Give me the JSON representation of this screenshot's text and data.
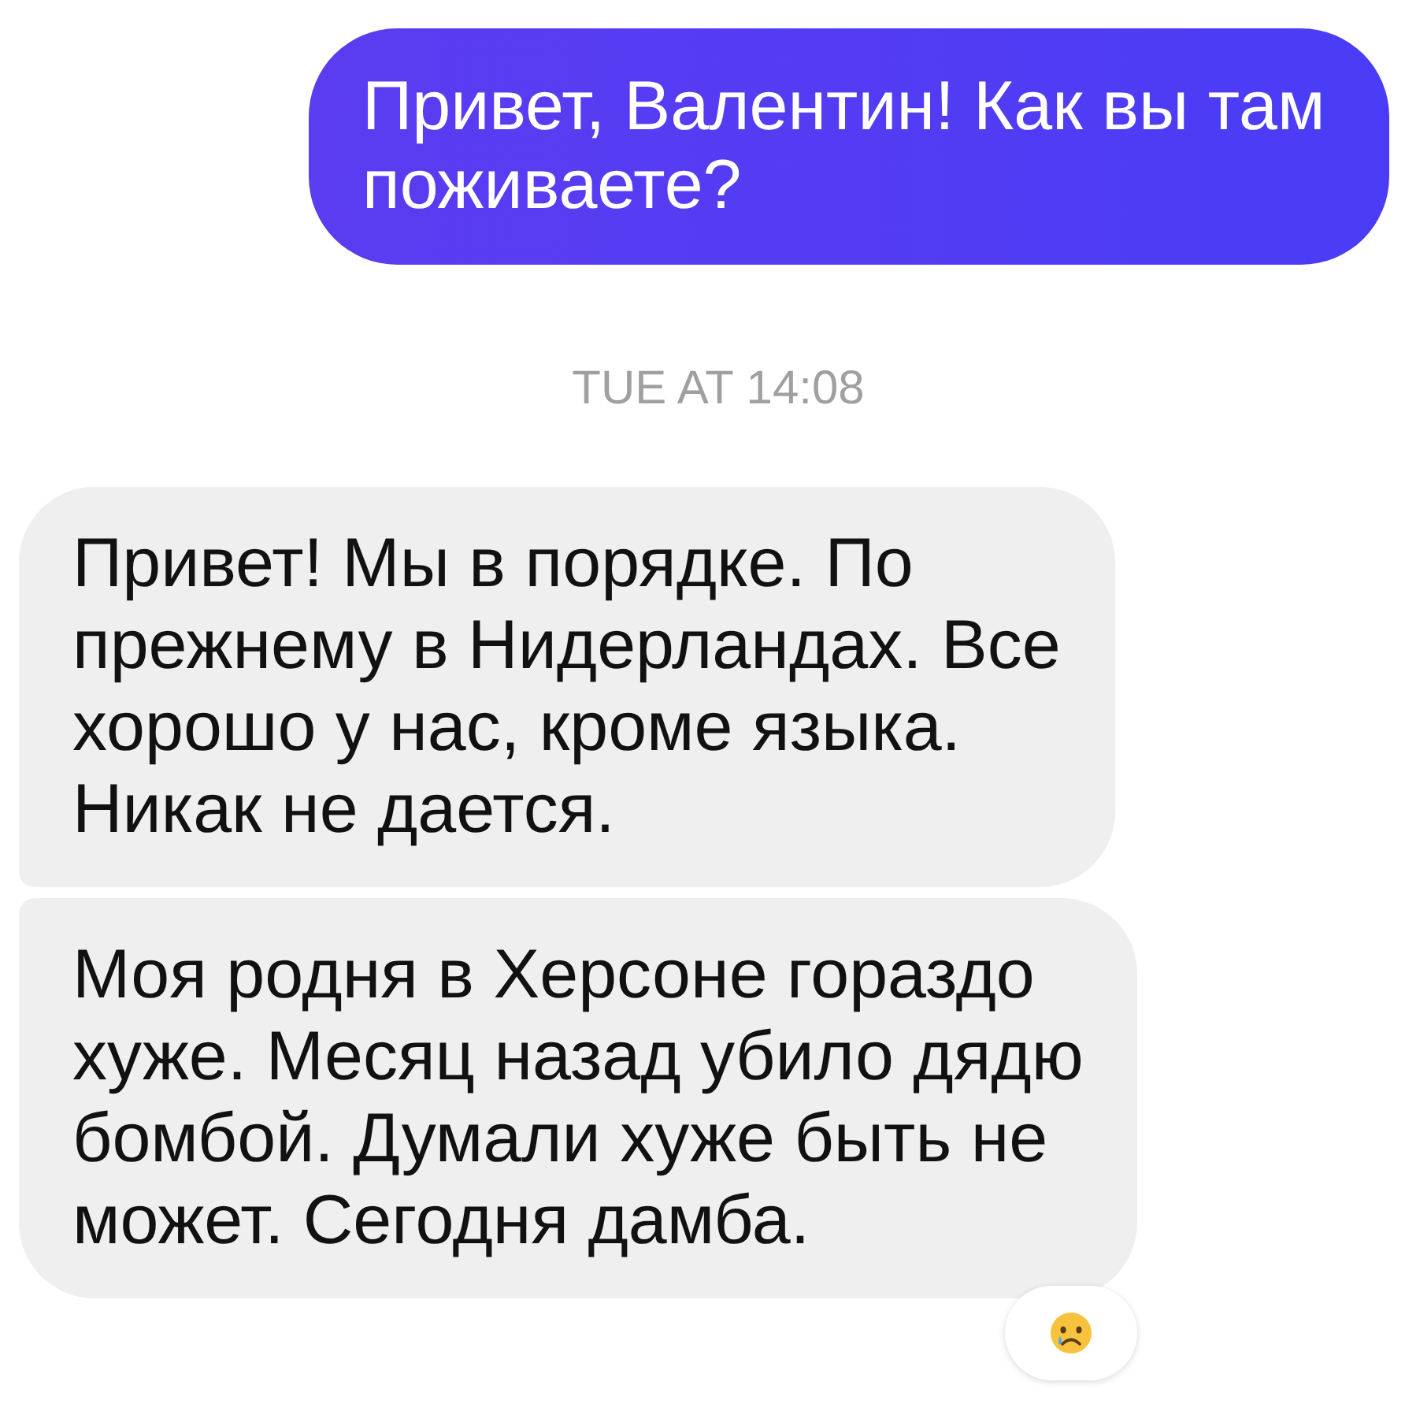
{
  "messages": [
    {
      "kind": "outgoing",
      "text": "Привет, Валентин! Как вы там поживаете?"
    },
    {
      "kind": "timestamp",
      "text": "TUE AT 14:08"
    },
    {
      "kind": "incoming",
      "joined_below": true,
      "text": "Привет! Мы в порядке. По прежнему в Нидерландах. Все хорошо у нас, кроме языка. Никак не дается."
    },
    {
      "kind": "incoming",
      "joined_below": false,
      "text": "Моя родня в Херсоне гораздо хуже. Месяц назад убило дядю бомбой. Думали хуже быть не может. Сегодня дамба.",
      "reaction": {
        "kind": "sad"
      }
    }
  ]
}
